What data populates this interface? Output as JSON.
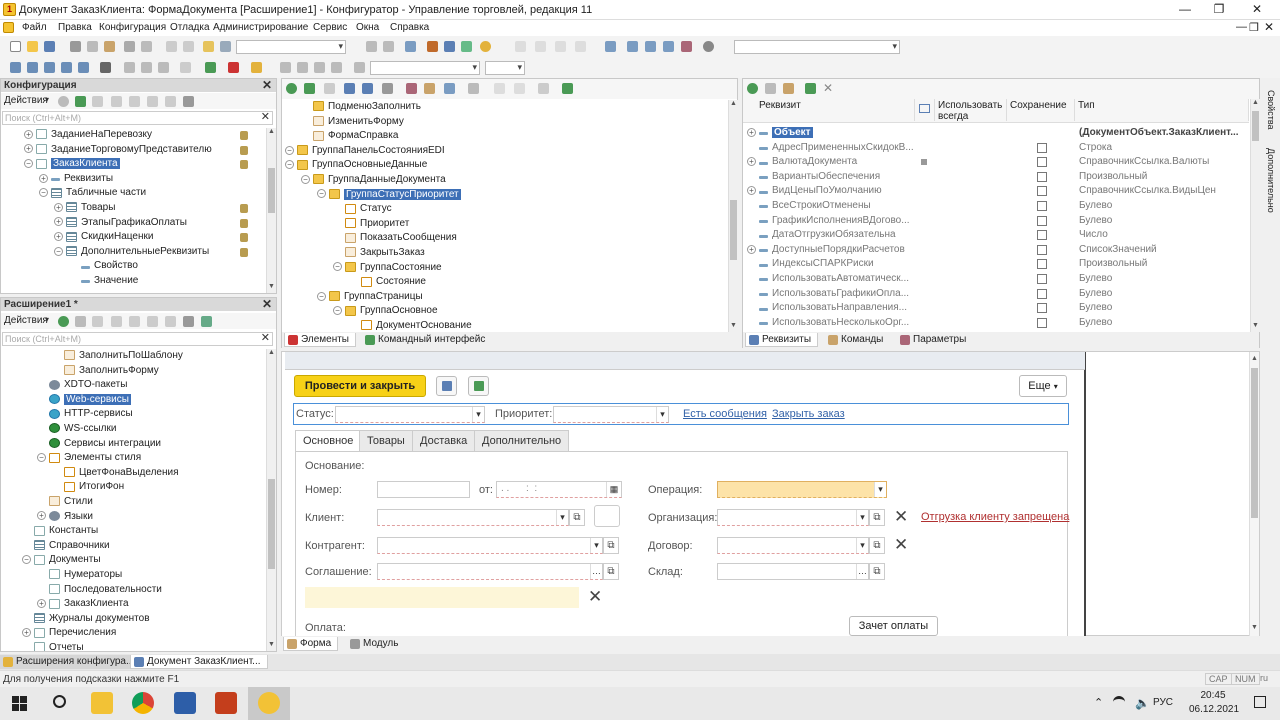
{
  "window": {
    "title": "Документ ЗаказКлиента: ФормаДокумента [Расширение1] - Конфигуратор - Управление торговлей, редакция 11",
    "app_icon": "1c-icon"
  },
  "menu": [
    "Файл",
    "Правка",
    "Конфигурация",
    "Отладка",
    "Администрирование",
    "Сервис",
    "Окна",
    "Справка"
  ],
  "config_panel": {
    "title": "Конфигурация",
    "actions_label": "Действия",
    "search_placeholder": "Поиск (Ctrl+Alt+M)",
    "items": [
      {
        "label": "ЗаданиеНаПеревозку",
        "indent": 1,
        "icon": "doc",
        "exp": "+"
      },
      {
        "label": "ЗаданиеТорговомуПредставителю",
        "indent": 1,
        "icon": "doc",
        "exp": "+"
      },
      {
        "label": "ЗаказКлиента",
        "indent": 1,
        "icon": "doc",
        "exp": "-",
        "selected": true
      },
      {
        "label": "Реквизиты",
        "indent": 2,
        "icon": "attr",
        "exp": "+"
      },
      {
        "label": "Табличные части",
        "indent": 2,
        "icon": "tbl",
        "exp": "-"
      },
      {
        "label": "Товары",
        "indent": 3,
        "icon": "tbl",
        "exp": "+"
      },
      {
        "label": "ЭтапыГрафикаОплаты",
        "indent": 3,
        "icon": "tbl",
        "exp": "+"
      },
      {
        "label": "СкидкиНаценки",
        "indent": 3,
        "icon": "tbl",
        "exp": "+"
      },
      {
        "label": "ДополнительныеРеквизиты",
        "indent": 3,
        "icon": "tbl",
        "exp": "-"
      },
      {
        "label": "Свойство",
        "indent": 4,
        "icon": "attr",
        "exp": ""
      },
      {
        "label": "Значение",
        "indent": 4,
        "icon": "attr",
        "exp": ""
      }
    ]
  },
  "ext_panel": {
    "title": "Расширение1 *",
    "actions_label": "Действия",
    "search_placeholder": "Поиск (Ctrl+Alt+M)",
    "items": [
      {
        "label": "ЗаполнитьПоШаблону",
        "indent": 3,
        "icon": "cmd",
        "exp": ""
      },
      {
        "label": "ЗаполнитьФорму",
        "indent": 3,
        "icon": "cmd",
        "exp": ""
      },
      {
        "label": "XDTO-пакеты",
        "indent": 2,
        "icon": "gear",
        "exp": ""
      },
      {
        "label": "Web-сервисы",
        "indent": 2,
        "icon": "globe",
        "exp": "",
        "selected": true
      },
      {
        "label": "HTTP-сервисы",
        "indent": 2,
        "icon": "globe",
        "exp": ""
      },
      {
        "label": "WS-ссылки",
        "indent": 2,
        "icon": "ws",
        "exp": ""
      },
      {
        "label": "Сервисы интеграции",
        "indent": 2,
        "icon": "ws",
        "exp": ""
      },
      {
        "label": "Элементы стиля",
        "indent": 2,
        "icon": "el",
        "exp": "-"
      },
      {
        "label": "ЦветФонаВыделения",
        "indent": 3,
        "icon": "el",
        "exp": ""
      },
      {
        "label": "ИтогиФон",
        "indent": 3,
        "icon": "el",
        "exp": ""
      },
      {
        "label": "Стили",
        "indent": 2,
        "icon": "cmd",
        "exp": ""
      },
      {
        "label": "Языки",
        "indent": 2,
        "icon": "gear",
        "exp": "+"
      },
      {
        "label": "Константы",
        "indent": 1,
        "icon": "doc",
        "exp": ""
      },
      {
        "label": "Справочники",
        "indent": 1,
        "icon": "tbl",
        "exp": ""
      },
      {
        "label": "Документы",
        "indent": 1,
        "icon": "doc",
        "exp": "-"
      },
      {
        "label": "Нумераторы",
        "indent": 2,
        "icon": "doc",
        "exp": ""
      },
      {
        "label": "Последовательности",
        "indent": 2,
        "icon": "doc",
        "exp": ""
      },
      {
        "label": "ЗаказКлиента",
        "indent": 2,
        "icon": "doc",
        "exp": "+"
      },
      {
        "label": "Журналы документов",
        "indent": 1,
        "icon": "tbl",
        "exp": ""
      },
      {
        "label": "Перечисления",
        "indent": 1,
        "icon": "doc",
        "exp": "+"
      },
      {
        "label": "Отчеты",
        "indent": 1,
        "icon": "doc",
        "exp": ""
      }
    ]
  },
  "elements_panel": {
    "items": [
      {
        "label": "ПодменюЗаполнить",
        "indent": 1,
        "icon": "folder",
        "exp": ""
      },
      {
        "label": "ИзменитьФорму",
        "indent": 1,
        "icon": "cmd",
        "exp": ""
      },
      {
        "label": "ФормаСправка",
        "indent": 1,
        "icon": "cmd",
        "exp": ""
      },
      {
        "label": "ГруппаПанельСостоянияEDI",
        "indent": 0,
        "icon": "folder",
        "exp": "-"
      },
      {
        "label": "ГруппаОсновныеДанные",
        "indent": 0,
        "icon": "folder",
        "exp": "-"
      },
      {
        "label": "ГруппаДанныеДокумента",
        "indent": 1,
        "icon": "folder",
        "exp": "-"
      },
      {
        "label": "ГруппаСтатусПриоритет",
        "indent": 2,
        "icon": "folder",
        "exp": "-",
        "selected": true
      },
      {
        "label": "Статус",
        "indent": 3,
        "icon": "el",
        "exp": ""
      },
      {
        "label": "Приоритет",
        "indent": 3,
        "icon": "el",
        "exp": ""
      },
      {
        "label": "ПоказатьСообщения",
        "indent": 3,
        "icon": "cmd",
        "exp": ""
      },
      {
        "label": "ЗакрытьЗаказ",
        "indent": 3,
        "icon": "cmd",
        "exp": ""
      },
      {
        "label": "ГруппаСостояние",
        "indent": 3,
        "icon": "folder",
        "exp": "-"
      },
      {
        "label": "Состояние",
        "indent": 4,
        "icon": "el",
        "exp": ""
      },
      {
        "label": "ГруппаСтраницы",
        "indent": 2,
        "icon": "folder",
        "exp": "-"
      },
      {
        "label": "ГруппаОсновное",
        "indent": 3,
        "icon": "folder",
        "exp": "-"
      },
      {
        "label": "ДокументОснование",
        "indent": 4,
        "icon": "el",
        "exp": ""
      }
    ],
    "tabs": [
      "Элементы",
      "Командный интерфейс"
    ]
  },
  "attrs_panel": {
    "headers": {
      "attr": "Реквизит",
      "use_always": "Использовать всегда",
      "save": "Сохранение",
      "type": "Тип"
    },
    "rows": [
      {
        "name": "Объект",
        "type": "(ДокументОбъект.ЗаказКлиент...",
        "exp": "+",
        "selected": true,
        "checkbox": false
      },
      {
        "name": "АдресПримененныхСкидокВ...",
        "type": "Строка",
        "exp": "",
        "checkbox": true
      },
      {
        "name": "ВалютаДокумента",
        "type": "СправочникСсылка.Валюты",
        "exp": "+",
        "checkbox": true,
        "use": true
      },
      {
        "name": "ВариантыОбеспечения",
        "type": "Произвольный",
        "exp": "",
        "checkbox": true
      },
      {
        "name": "ВидЦеныПоУмолчанию",
        "type": "СправочникСсылка.ВидыЦен",
        "exp": "+",
        "checkbox": true
      },
      {
        "name": "ВсеСтрокиОтменены",
        "type": "Булево",
        "exp": "",
        "checkbox": true
      },
      {
        "name": "ГрафикИсполненияВДогово...",
        "type": "Булево",
        "exp": "",
        "checkbox": true
      },
      {
        "name": "ДатаОтгрузкиОбязательна",
        "type": "Число",
        "exp": "",
        "checkbox": true
      },
      {
        "name": "ДоступныеПорядкиРасчетов",
        "type": "СписокЗначений",
        "exp": "+",
        "checkbox": true
      },
      {
        "name": "ИндексыСПАРКРиски",
        "type": "Произвольный",
        "exp": "",
        "checkbox": true
      },
      {
        "name": "ИспользоватьАвтоматическ...",
        "type": "Булево",
        "exp": "",
        "checkbox": true
      },
      {
        "name": "ИспользоватьГрафикиОпла...",
        "type": "Булево",
        "exp": "",
        "checkbox": true
      },
      {
        "name": "ИспользоватьНаправления...",
        "type": "Булево",
        "exp": "",
        "checkbox": true
      },
      {
        "name": "ИспользоватьНесколькоОрг...",
        "type": "Булево",
        "exp": "",
        "checkbox": true
      }
    ],
    "tabs": [
      "Реквизиты",
      "Команды",
      "Параметры"
    ]
  },
  "side_tabs": [
    "Свойства",
    "Дополнительно"
  ],
  "form_preview": {
    "post_close": "Провести и закрыть",
    "more": "Еще",
    "status_label": "Статус:",
    "priority_label": "Приоритет:",
    "messages_link": "Есть сообщения",
    "close_order_link": "Закрыть заказ",
    "tabs": [
      "Основное",
      "Товары",
      "Доставка",
      "Дополнительно"
    ],
    "basis_label": "Основание:",
    "number_label": "Номер:",
    "from_label": "от:",
    "date_mask": ". .      :  :",
    "operation_label": "Операция:",
    "client_label": "Клиент:",
    "organization_label": "Организация:",
    "shipment_forbidden_link": "Отгрузка клиенту запрещена",
    "contractor_label": "Контрагент:",
    "contract_label": "Договор:",
    "agreement_label": "Соглашение:",
    "warehouse_label": "Склад:",
    "payment_label": "Оплата:",
    "payment_offset_button": "Зачет оплаты",
    "bottom_tabs": [
      "Форма",
      "Модуль"
    ]
  },
  "window_tabs": [
    "Расширения конфигура...",
    "Документ ЗаказКлиент..."
  ],
  "status": {
    "hint": "Для получения подсказки нажмите F1",
    "caps": "CAP",
    "num": "NUM",
    "lang_short": "ru"
  },
  "taskbar": {
    "lang": "РУС",
    "time": "20:45",
    "date": "06.12.2021"
  },
  "colors": {
    "accent_yellow": "#f7d117",
    "selection": "#3d6fb6",
    "link": "#3262a8",
    "error_link": "#b03030"
  }
}
